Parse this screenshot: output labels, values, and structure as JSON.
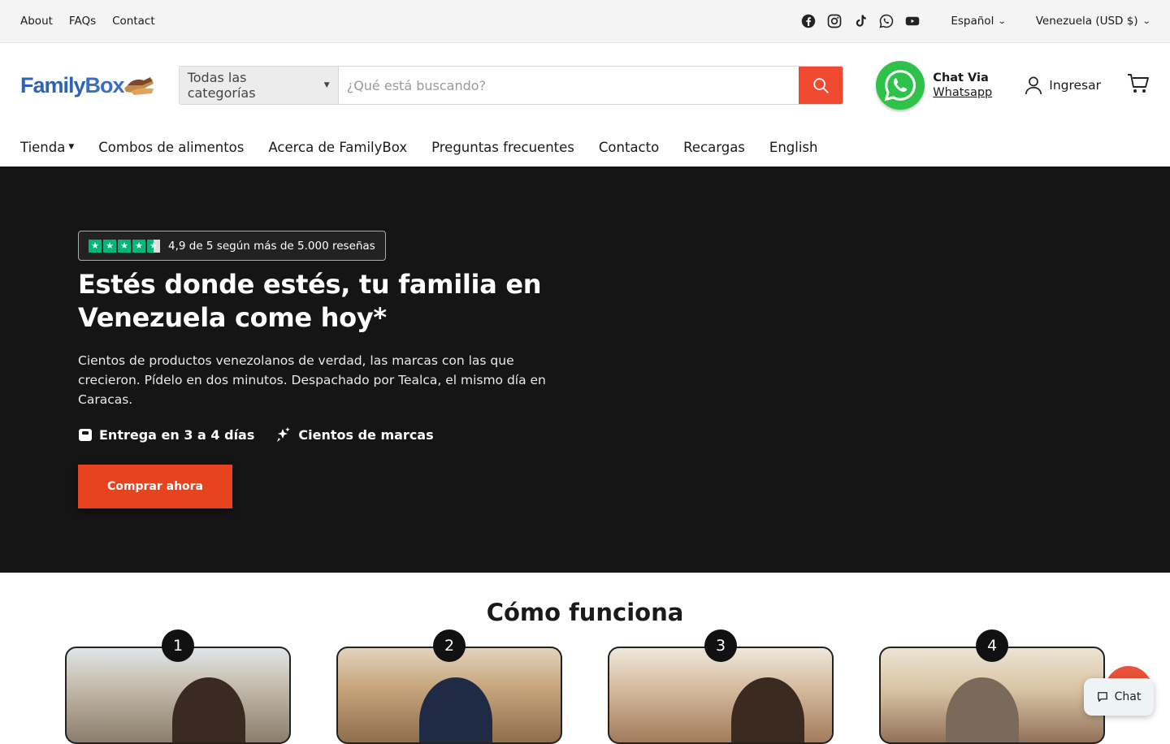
{
  "topbar": {
    "links": [
      "About",
      "FAQs",
      "Contact"
    ],
    "language": "Español",
    "region": "Venezuela (USD $)"
  },
  "header": {
    "logo_text_family": "Family",
    "logo_text_box": "Box",
    "search": {
      "category": "Todas las categorías",
      "placeholder": "¿Qué está buscando?",
      "value": ""
    },
    "whatsapp": {
      "title": "Chat Via",
      "link": "Whatsapp"
    },
    "login_label": "Ingresar"
  },
  "nav": {
    "shop": "Tienda",
    "items": [
      "Combos de alimentos",
      "Acerca de FamilyBox",
      "Preguntas frecuentes",
      "Contacto",
      "Recargas",
      "English"
    ]
  },
  "hero": {
    "rating_text": "4,9 de 5 según más de 5.000 reseñas",
    "stars": 4.5,
    "title": "Estés donde estés, tu familia en Venezuela come hoy*",
    "description": "Cientos de productos venezolanos de verdad, las marcas con las que crecieron. Pídelo en dos minutos. Despachado por Tealca, el mismo día en Caracas.",
    "feature_1": "Entrega en 3 a 4 días",
    "feature_2": "Cientos de marcas",
    "cta": "Comprar ahora"
  },
  "how": {
    "title": "Cómo funciona",
    "steps": [
      "1",
      "2",
      "3",
      "4"
    ]
  },
  "chat_widget": "Chat",
  "colors": {
    "accent": "#ef4a2f",
    "hero_bg": "#151515",
    "whatsapp": "#2fc24a",
    "trustpilot": "#00b67a",
    "brand_blue": "#2f63b5"
  }
}
